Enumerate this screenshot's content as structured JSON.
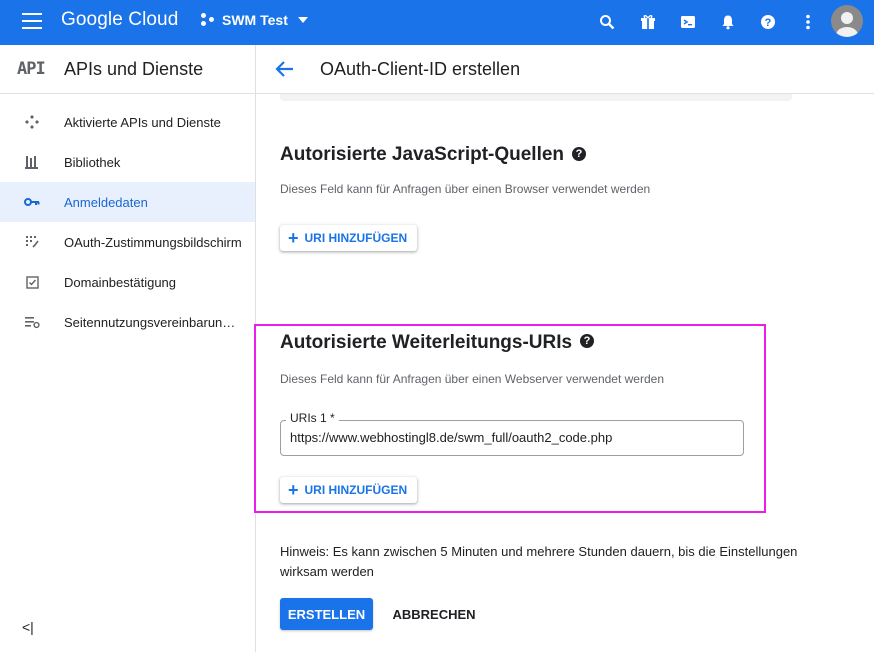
{
  "topbar": {
    "logo": "Google Cloud",
    "project": "SWM Test",
    "icons": [
      "menu-icon",
      "project-icon",
      "search-icon",
      "gift-icon",
      "terminal-icon",
      "bell-icon",
      "help-icon",
      "more-vert-icon",
      "avatar"
    ]
  },
  "sidebar": {
    "badge": "API",
    "title": "APIs und Dienste",
    "items": [
      {
        "label": "Aktivierte APIs und Dienste",
        "icon": "dashboard-icon",
        "active": false
      },
      {
        "label": "Bibliothek",
        "icon": "library-icon",
        "active": false
      },
      {
        "label": "Anmeldedaten",
        "icon": "key-icon",
        "active": true
      },
      {
        "label": "OAuth-Zustimmungsbildschirm",
        "icon": "consent-icon",
        "active": false
      },
      {
        "label": "Domainbestätigung",
        "icon": "checkbox-icon",
        "active": false
      },
      {
        "label": "Seitennutzungsvereinbarungen",
        "icon": "settings-list-icon",
        "active": false
      }
    ],
    "collapse_label": "<|"
  },
  "main": {
    "title": "OAuth-Client-ID erstellen",
    "js_section": {
      "heading": "Autorisierte JavaScript-Quellen",
      "description": "Dieses Feld kann für Anfragen über einen Browser verwendet werden",
      "add_button": "URI HINZUFÜGEN"
    },
    "redirect_section": {
      "heading": "Autorisierte Weiterleitungs-URIs",
      "description": "Dieses Feld kann für Anfragen über einen Webserver verwendet werden",
      "field_label": "URIs 1 *",
      "field_value": "https://www.webhostingl8.de/swm_full/oauth2_code.php",
      "add_button": "URI HINZUFÜGEN"
    },
    "note": "Hinweis: Es kann zwischen 5 Minuten und mehrere Stunden dauern, bis die Einstellungen wirksam werden",
    "create_button": "ERSTELLEN",
    "cancel_button": "ABBRECHEN"
  },
  "colors": {
    "brand": "#1a73e8",
    "highlight": "#e91ee9",
    "active_bg": "#e8f0fe"
  }
}
